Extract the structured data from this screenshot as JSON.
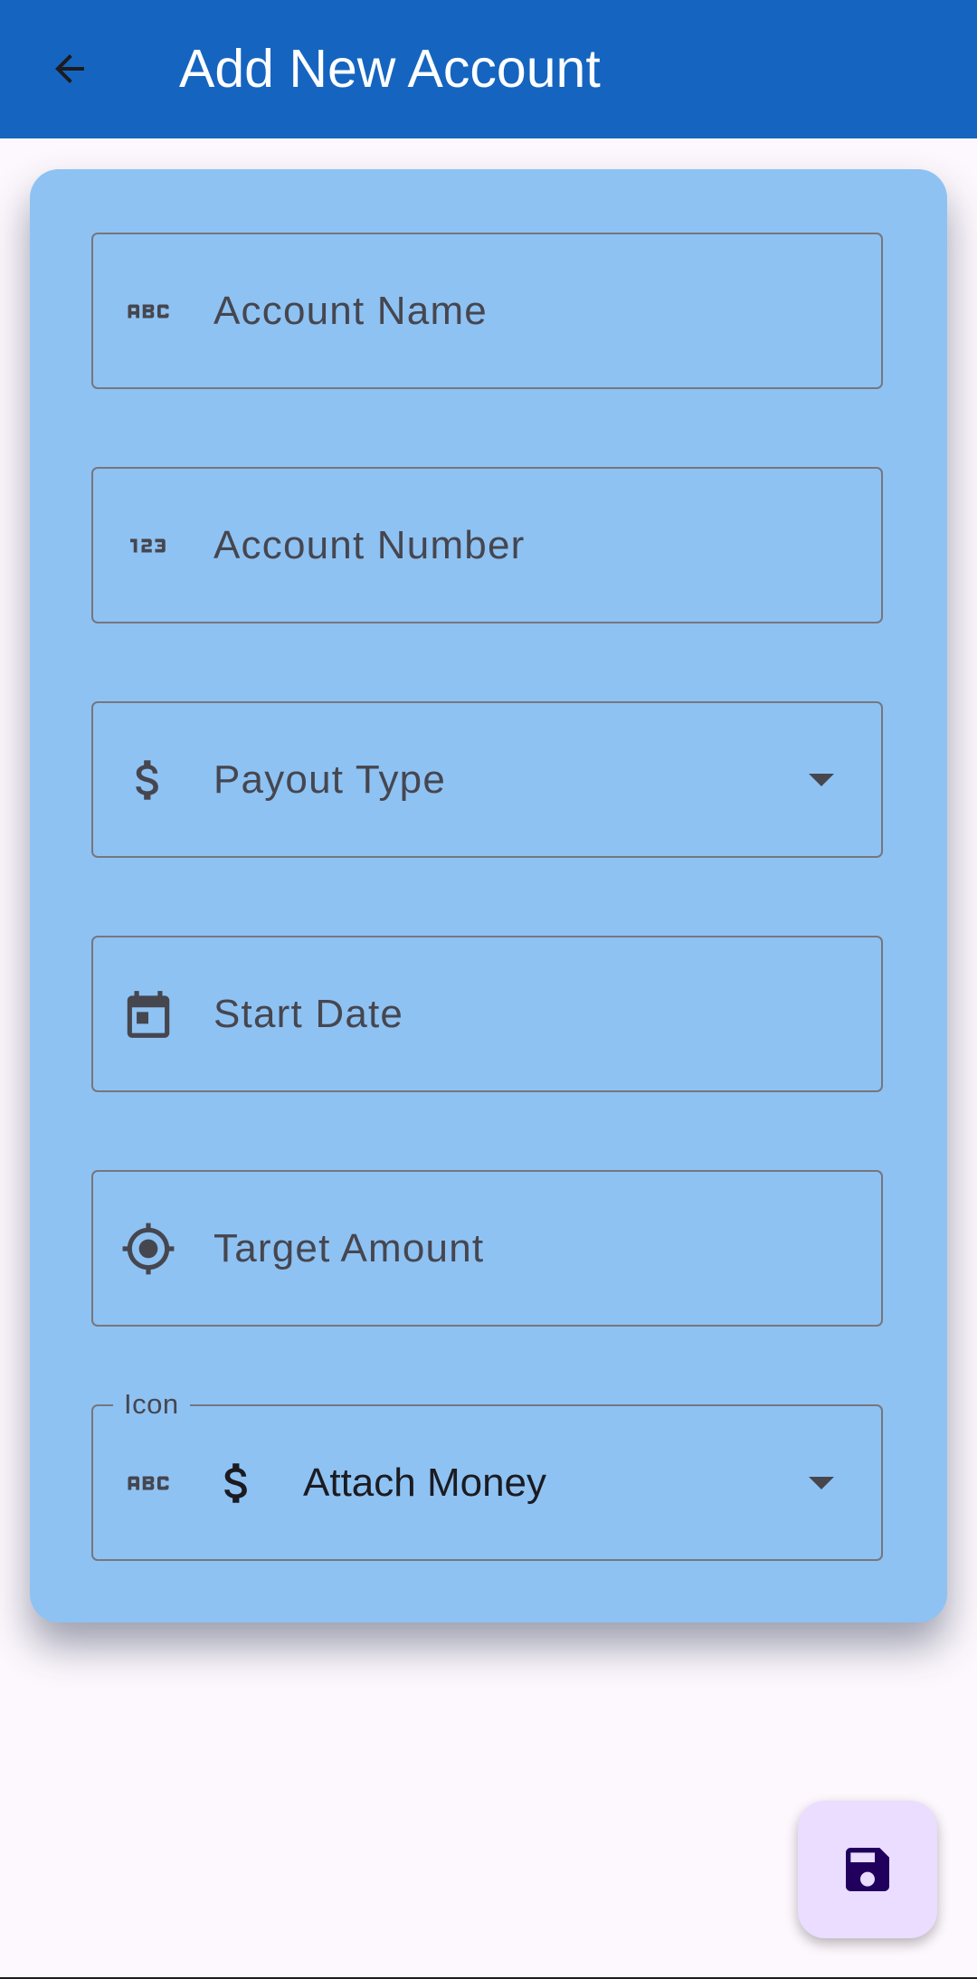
{
  "appbar": {
    "title": "Add New Account",
    "color": "#1565c0"
  },
  "form": {
    "fields": [
      {
        "placeholder": "Account Name",
        "icon": "abc-icon"
      },
      {
        "placeholder": "Account Number",
        "icon": "123-icon"
      },
      {
        "placeholder": "Payout Type",
        "icon": "dollar-icon",
        "type": "dropdown"
      },
      {
        "placeholder": "Start Date",
        "icon": "calendar-icon"
      },
      {
        "placeholder": "Target Amount",
        "icon": "target-icon"
      }
    ],
    "icon_select": {
      "label": "Icon",
      "value": "Attach Money",
      "prefix_icon": "abc-icon",
      "value_icon": "dollar-icon"
    }
  },
  "fab": {
    "icon": "save-icon"
  },
  "colors": {
    "card": "#8ec2f3",
    "fab": "#eaddff",
    "fab_icon": "#21005d"
  }
}
